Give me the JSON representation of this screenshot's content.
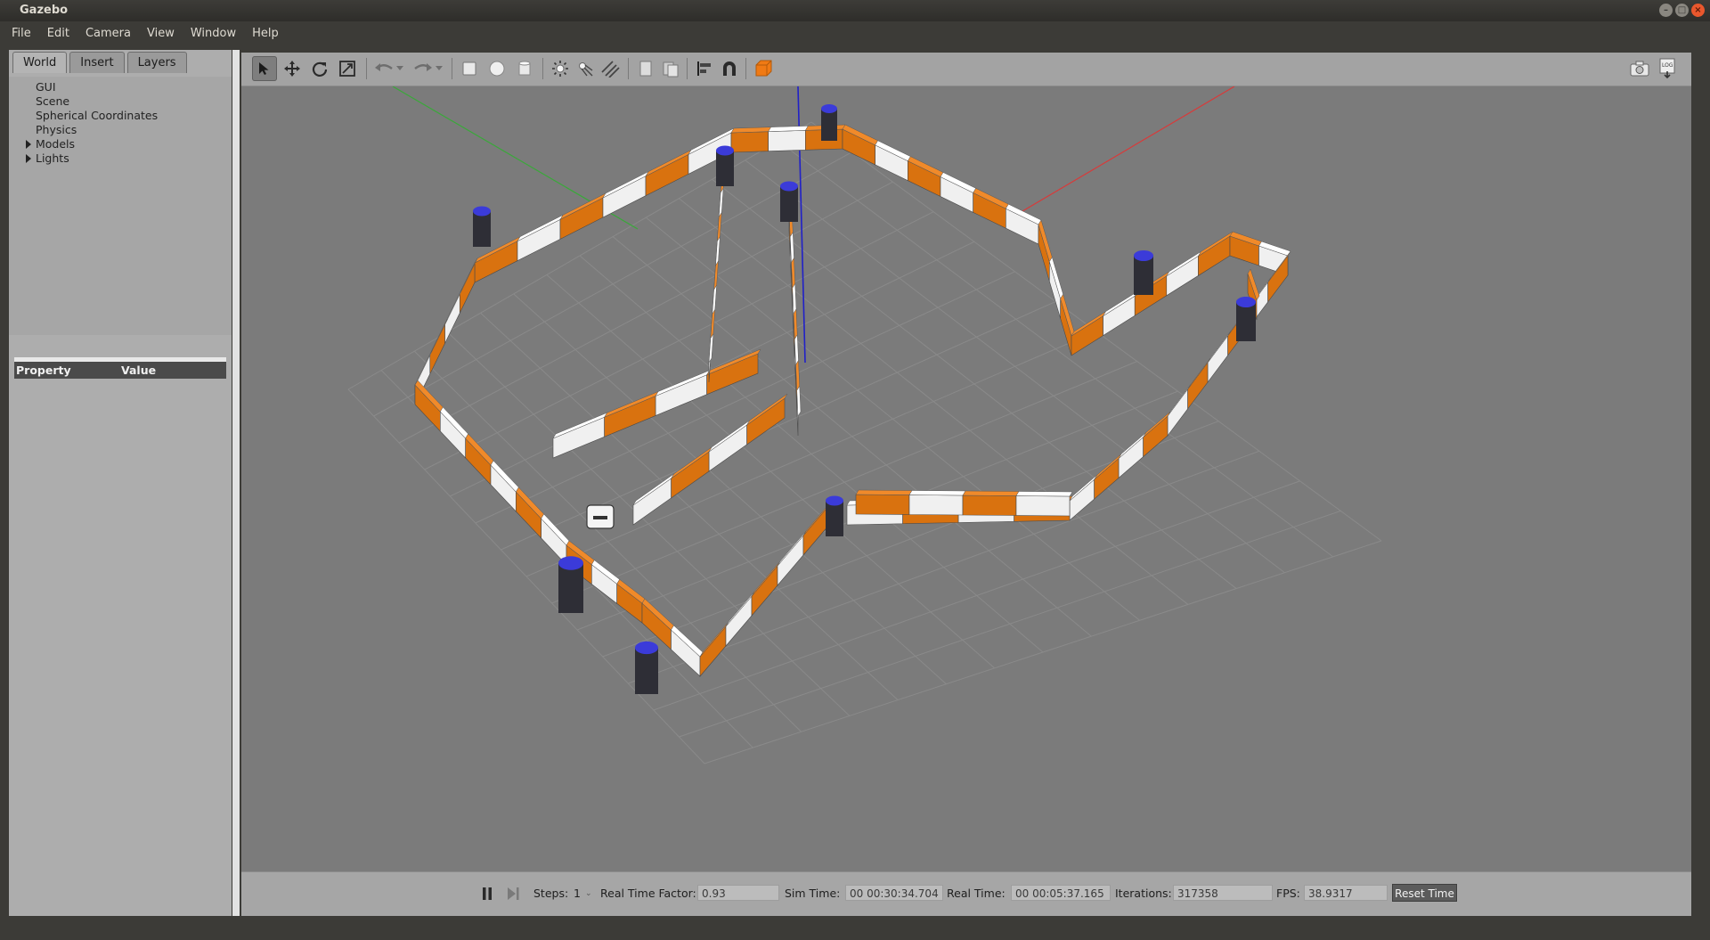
{
  "window": {
    "title": "Gazebo"
  },
  "menu": [
    "File",
    "Edit",
    "Camera",
    "View",
    "Window",
    "Help"
  ],
  "left_panel": {
    "tabs": [
      "World",
      "Insert",
      "Layers"
    ],
    "active_tab": "World",
    "tree": [
      {
        "label": "GUI",
        "expandable": false
      },
      {
        "label": "Scene",
        "expandable": false
      },
      {
        "label": "Spherical Coordinates",
        "expandable": false
      },
      {
        "label": "Physics",
        "expandable": false
      },
      {
        "label": "Models",
        "expandable": true
      },
      {
        "label": "Lights",
        "expandable": true
      }
    ],
    "property_header": {
      "property": "Property",
      "value": "Value"
    }
  },
  "toolbar": {
    "tools": [
      "select-arrow-icon",
      "translate-icon",
      "rotate-icon",
      "scale-icon",
      "undo-icon",
      "undo-history-icon",
      "redo-icon",
      "redo-history-icon",
      "box-icon",
      "sphere-icon",
      "cylinder-icon",
      "point-light-icon",
      "spot-light-icon",
      "directional-light-icon",
      "copy-icon",
      "paste-icon",
      "align-icon",
      "snap-magnet-icon",
      "view-angle-icon"
    ],
    "right_tools": [
      "screenshot-icon",
      "log-icon"
    ]
  },
  "status": {
    "steps_label": "Steps:",
    "steps_value": "1",
    "rtf_label": "Real Time Factor:",
    "rtf_value": "0.93",
    "sim_label": "Sim Time:",
    "sim_value": "00 00:30:34.704",
    "real_label": "Real Time:",
    "real_value": "00 00:05:37.165",
    "iter_label": "Iterations:",
    "iter_value": "317358",
    "fps_label": "FPS:",
    "fps_value": "38.9317",
    "reset_label": "Reset Time"
  },
  "colors": {
    "wall_orange": "#d9720f",
    "wall_white": "#f0f0f0",
    "post_blue": "#3b3bd9",
    "ground": "#7b7b7b",
    "axis_x": "#d83a3a",
    "axis_y": "#3aa83a",
    "axis_z": "#2020c8"
  }
}
